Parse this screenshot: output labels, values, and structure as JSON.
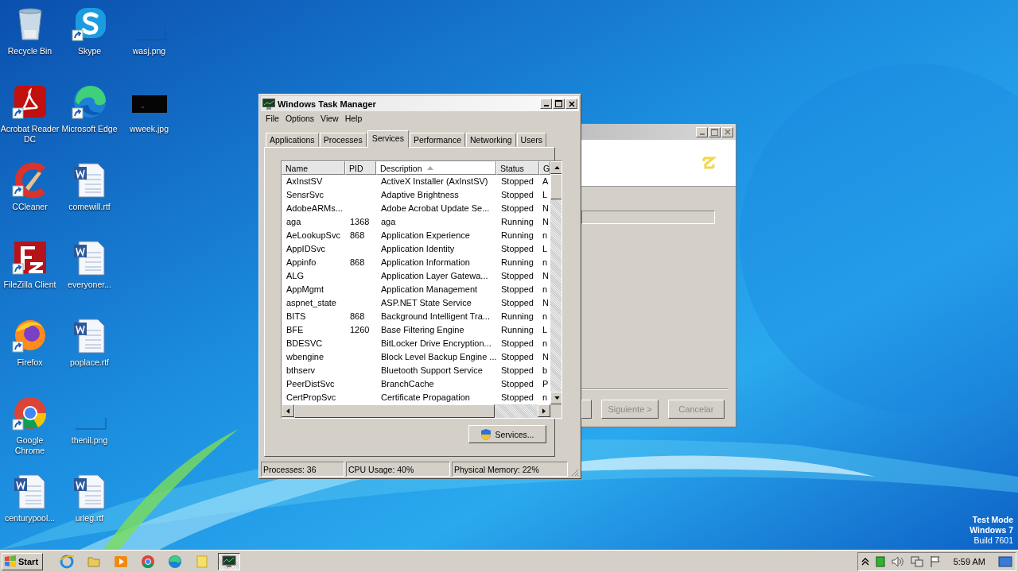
{
  "desktop_icons": [
    {
      "label": "Recycle Bin",
      "kind": "recycle",
      "shortcut": false
    },
    {
      "label": "Acrobat Reader DC",
      "kind": "acrobat",
      "shortcut": true
    },
    {
      "label": "CCleaner",
      "kind": "ccleaner",
      "shortcut": true
    },
    {
      "label": "FileZilla Client",
      "kind": "filezilla",
      "shortcut": true
    },
    {
      "label": "Firefox",
      "kind": "firefox",
      "shortcut": true
    },
    {
      "label": "Google Chrome",
      "kind": "chrome",
      "shortcut": true
    },
    {
      "label": "centurypool...",
      "kind": "word",
      "shortcut": false
    },
    {
      "label": "Skype",
      "kind": "skype",
      "shortcut": true
    },
    {
      "label": "Microsoft Edge",
      "kind": "edge",
      "shortcut": true
    },
    {
      "label": "comewill.rtf",
      "kind": "word",
      "shortcut": false
    },
    {
      "label": "everyoner...",
      "kind": "word",
      "shortcut": false
    },
    {
      "label": "poplace.rtf",
      "kind": "word",
      "shortcut": false
    },
    {
      "label": "thenil.png",
      "kind": "image-light",
      "shortcut": false
    },
    {
      "label": "urleg.rtf",
      "kind": "word",
      "shortcut": false
    },
    {
      "label": "wasj.png",
      "kind": "image-light",
      "shortcut": false
    },
    {
      "label": "wweek.jpg",
      "kind": "image-dark",
      "shortcut": false
    }
  ],
  "background_window": {
    "buttons": [
      {
        "label": "Siguiente >"
      },
      {
        "label": "Cancelar"
      }
    ]
  },
  "task_manager": {
    "title": "Windows Task Manager",
    "menu": [
      "File",
      "Options",
      "View",
      "Help"
    ],
    "tabs": [
      {
        "label": "Applications",
        "selected": false
      },
      {
        "label": "Processes",
        "selected": false
      },
      {
        "label": "Services",
        "selected": true
      },
      {
        "label": "Performance",
        "selected": false
      },
      {
        "label": "Networking",
        "selected": false
      },
      {
        "label": "Users",
        "selected": false
      }
    ],
    "columns": [
      {
        "label": "Name",
        "sorted": false
      },
      {
        "label": "PID",
        "sorted": false
      },
      {
        "label": "Description",
        "sorted": true
      },
      {
        "label": "Status",
        "sorted": false
      },
      {
        "label": "G",
        "sorted": false
      }
    ],
    "rows": [
      {
        "name": "AxInstSV",
        "pid": "",
        "description": "ActiveX Installer (AxInstSV)",
        "status": "Stopped",
        "column_5": "A"
      },
      {
        "name": "SensrSvc",
        "pid": "",
        "description": "Adaptive Brightness",
        "status": "Stopped",
        "column_5": "L"
      },
      {
        "name": "AdobeARMs...",
        "pid": "",
        "description": "Adobe Acrobat Update Se...",
        "status": "Stopped",
        "column_5": "N"
      },
      {
        "name": "aga",
        "pid": "1368",
        "description": "aga",
        "status": "Running",
        "column_5": "N"
      },
      {
        "name": "AeLookupSvc",
        "pid": "868",
        "description": "Application Experience",
        "status": "Running",
        "column_5": "n"
      },
      {
        "name": "AppIDSvc",
        "pid": "",
        "description": "Application Identity",
        "status": "Stopped",
        "column_5": "L"
      },
      {
        "name": "Appinfo",
        "pid": "868",
        "description": "Application Information",
        "status": "Running",
        "column_5": "n"
      },
      {
        "name": "ALG",
        "pid": "",
        "description": "Application Layer Gatewa...",
        "status": "Stopped",
        "column_5": "N"
      },
      {
        "name": "AppMgmt",
        "pid": "",
        "description": "Application Management",
        "status": "Stopped",
        "column_5": "n"
      },
      {
        "name": "aspnet_state",
        "pid": "",
        "description": "ASP.NET State Service",
        "status": "Stopped",
        "column_5": "N"
      },
      {
        "name": "BITS",
        "pid": "868",
        "description": "Background Intelligent Tra...",
        "status": "Running",
        "column_5": "n"
      },
      {
        "name": "BFE",
        "pid": "1260",
        "description": "Base Filtering Engine",
        "status": "Running",
        "column_5": "L"
      },
      {
        "name": "BDESVC",
        "pid": "",
        "description": "BitLocker Drive Encryption...",
        "status": "Stopped",
        "column_5": "n"
      },
      {
        "name": "wbengine",
        "pid": "",
        "description": "Block Level Backup Engine ...",
        "status": "Stopped",
        "column_5": "N"
      },
      {
        "name": "bthserv",
        "pid": "",
        "description": "Bluetooth Support Service",
        "status": "Stopped",
        "column_5": "b"
      },
      {
        "name": "PeerDistSvc",
        "pid": "",
        "description": "BranchCache",
        "status": "Stopped",
        "column_5": "P"
      },
      {
        "name": "CertPropSvc",
        "pid": "",
        "description": "Certificate Propagation",
        "status": "Stopped",
        "column_5": "n"
      }
    ],
    "services_button": "Services...",
    "status_bar": [
      "Processes: 36",
      "CPU Usage: 40%",
      "Physical Memory: 22%"
    ]
  },
  "os_notice": [
    "Test Mode",
    "Windows 7",
    "Build 7601"
  ],
  "taskbar": {
    "start": "Start",
    "apps": [
      {
        "kind": "ie",
        "selected": false
      },
      {
        "kind": "explorer",
        "selected": false
      },
      {
        "kind": "media",
        "selected": false
      },
      {
        "kind": "chrome",
        "selected": false
      },
      {
        "kind": "edge",
        "selected": false
      },
      {
        "kind": "installer",
        "selected": false
      },
      {
        "kind": "taskmgr",
        "selected": true
      }
    ],
    "clock": "5:59 AM"
  }
}
